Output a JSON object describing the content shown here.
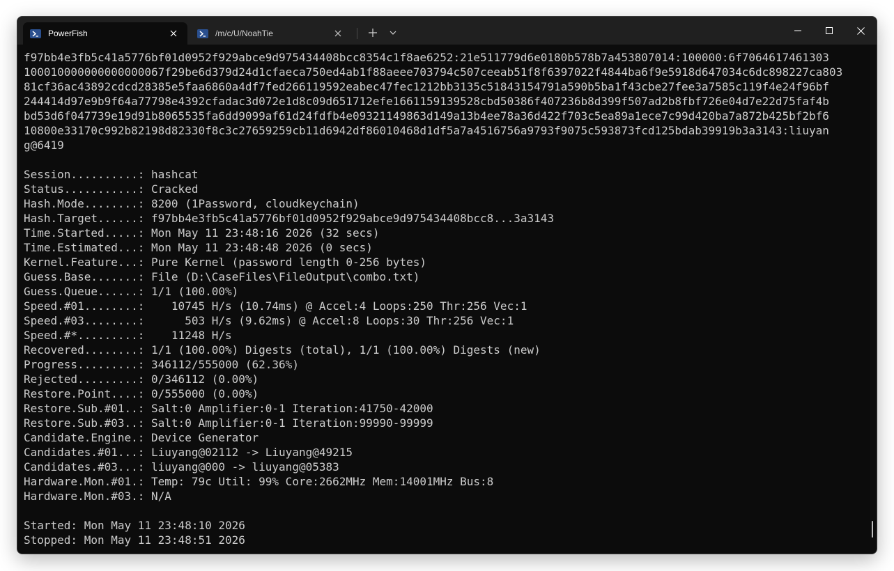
{
  "tabs": [
    {
      "label": "PowerFish",
      "icon": "powershell-icon",
      "active": true
    },
    {
      "label": "/m/c/U/NoahTie",
      "icon": "powershell-icon",
      "active": false
    }
  ],
  "colors": {
    "terminal_bg": "#0c0c0c",
    "terminal_fg": "#cccccc",
    "titlebar_bg": "#202020",
    "tab_icon": "#2a4f8e"
  },
  "terminal": {
    "lines": [
      "f97bb4e3fb5c41a5776bf01d0952f929abce9d975434408bcc8354c1f8ae6252:21e511779d6e0180b578b7a453807014:100000:6f7064617461303",
      "100010000000000000067f29be6d379d24d1cfaeca750ed4ab1f88aeee703794c507ceeab51f8f6397022f4844ba6f9e5918d647034c6dc898227ca803",
      "81cf36ac43892cdcd28385e5faa6860a4df7fed266119592eabec47fec1212bb3135c51843154791a590b5ba1f43cbe27fee3a7585c119f4e24f96bf",
      "244414d97e9b9f64a77798e4392cfadac3d072e1d8c09d651712efe1661159139528cbd50386f407236b8d399f507ad2b8fbf726e04d7e22d75faf4b",
      "bd53d6f047739e19d91b8065535fa6dd9099af61d24fdfb4e09321149863d149a13b4ee78a36d422f703c5ea89a1ece7c99d420ba7a872b425bf2bf6",
      "10800e33170c992b82198d82330f8c3c27659259cb11d6942df86010468d1df5a7a4516756a9793f9075c593873fcd125bdab39919b3a3143:liuyan",
      "g@6419",
      "",
      "Session..........: hashcat",
      "Status...........: Cracked",
      "Hash.Mode........: 8200 (1Password, cloudkeychain)",
      "Hash.Target......: f97bb4e3fb5c41a5776bf01d0952f929abce9d975434408bcc8...3a3143",
      "Time.Started.....: Mon May 11 23:48:16 2026 (32 secs)",
      "Time.Estimated...: Mon May 11 23:48:48 2026 (0 secs)",
      "Kernel.Feature...: Pure Kernel (password length 0-256 bytes)",
      "Guess.Base.......: File (D:\\CaseFiles\\FileOutput\\combo.txt)",
      "Guess.Queue......: 1/1 (100.00%)",
      "Speed.#01........:    10745 H/s (10.74ms) @ Accel:4 Loops:250 Thr:256 Vec:1",
      "Speed.#03........:      503 H/s (9.62ms) @ Accel:8 Loops:30 Thr:256 Vec:1",
      "Speed.#*.........:    11248 H/s",
      "Recovered........: 1/1 (100.00%) Digests (total), 1/1 (100.00%) Digests (new)",
      "Progress.........: 346112/555000 (62.36%)",
      "Rejected.........: 0/346112 (0.00%)",
      "Restore.Point....: 0/555000 (0.00%)",
      "Restore.Sub.#01..: Salt:0 Amplifier:0-1 Iteration:41750-42000",
      "Restore.Sub.#03..: Salt:0 Amplifier:0-1 Iteration:99990-99999",
      "Candidate.Engine.: Device Generator",
      "Candidates.#01...: Liuyang@02112 -> Liuyang@49215",
      "Candidates.#03...: liuyang@000 -> liuyang@05383",
      "Hardware.Mon.#01.: Temp: 79c Util: 99% Core:2662MHz Mem:14001MHz Bus:8",
      "Hardware.Mon.#03.: N/A",
      "",
      "Started: Mon May 11 23:48:10 2026",
      "Stopped: Mon May 11 23:48:51 2026"
    ]
  }
}
